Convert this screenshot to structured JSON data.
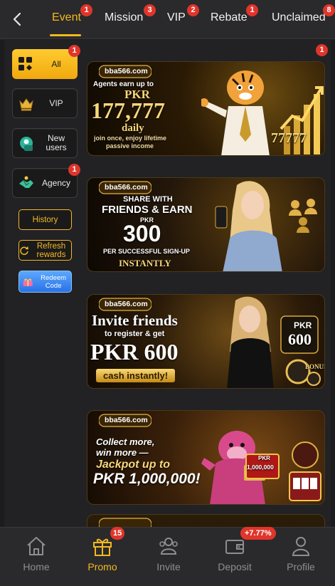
{
  "tabs": [
    {
      "label": "Event",
      "badge": "1",
      "active": true
    },
    {
      "label": "Mission",
      "badge": "3"
    },
    {
      "label": "VIP",
      "badge": "2"
    },
    {
      "label": "Rebate",
      "badge": "1"
    },
    {
      "label": "Unclaimed",
      "badge": "8"
    }
  ],
  "sidebar": {
    "items": [
      {
        "label": "All",
        "badge": "1",
        "icon": "grid-icon",
        "active": true
      },
      {
        "label": "VIP",
        "icon": "crown-icon"
      },
      {
        "label": "New users",
        "icon": "new-user-icon"
      },
      {
        "label": "Agency",
        "badge": "1",
        "icon": "handshake-icon"
      }
    ],
    "history": "History",
    "refresh": "Refresh rewards",
    "redeem": "Redeem Code"
  },
  "list_badge": "1",
  "banners": {
    "brand": "bba566.com",
    "b1": {
      "line1": "Agents earn up to",
      "line2": "PKR",
      "amount": "177,777",
      "line3": "daily",
      "line4": "join once, enjoy lifetime",
      "line5": "passive income",
      "deco": "77777"
    },
    "b2": {
      "line1": "SHARE WITH",
      "line2": "FRIENDS & EARN",
      "line3": "PKR",
      "amount": "300",
      "line4": "PER SUCCESSFUL SIGN-UP",
      "line5": "INSTANTLY"
    },
    "b3": {
      "line1": "Invite friends",
      "line2": "to register & get",
      "amount": "PKR 600",
      "ribbon": "cash instantly!",
      "chip1": "PKR",
      "chip2": "600",
      "chip3": "BONUS"
    },
    "b4": {
      "line1": "Collect more,",
      "line2": "win more —",
      "line3": "Jackpot up to",
      "amount": "PKR 1,000,000!",
      "sign1": "PKR",
      "sign2": "1,000,000"
    }
  },
  "bottom_nav": [
    {
      "label": "Home",
      "icon": "home-icon"
    },
    {
      "label": "Promo",
      "icon": "gift-icon",
      "badge": "15",
      "active": true
    },
    {
      "label": "Invite",
      "icon": "invite-icon"
    },
    {
      "label": "Deposit",
      "icon": "wallet-icon",
      "badge": "+7.77%"
    },
    {
      "label": "Profile",
      "icon": "profile-icon"
    }
  ],
  "colors": {
    "accent": "#f5b820",
    "badge": "#e0352b",
    "background": "#1c1c1e"
  }
}
